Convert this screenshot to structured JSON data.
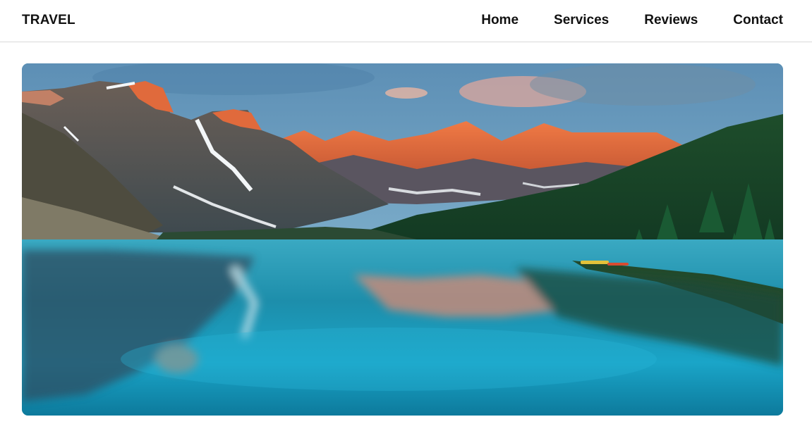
{
  "header": {
    "brand": "TRAVEL",
    "nav": [
      {
        "label": "Home"
      },
      {
        "label": "Services"
      },
      {
        "label": "Reviews"
      },
      {
        "label": "Contact"
      }
    ]
  },
  "hero": {
    "image": "mountain-lake-landscape",
    "colors": {
      "sky": "#5f8fb4",
      "peak_glow": "#e0663a",
      "forest": "#1f4a2a",
      "lake": "#1a9fc0"
    }
  }
}
